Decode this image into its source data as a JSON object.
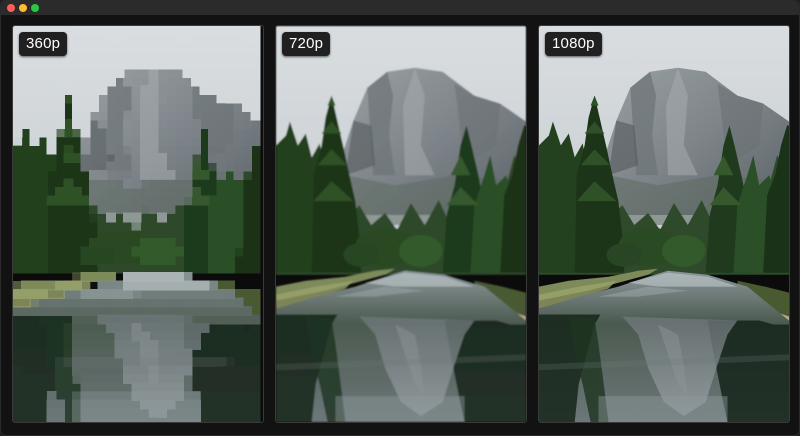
{
  "window": {
    "controls": [
      "close",
      "minimize",
      "zoom"
    ],
    "control_colors": {
      "close": "#ff5f57",
      "minimize": "#febc2e",
      "zoom": "#28c840"
    }
  },
  "panels": [
    {
      "label": "360p"
    },
    {
      "label": "720p"
    },
    {
      "label": "1080p"
    }
  ]
}
